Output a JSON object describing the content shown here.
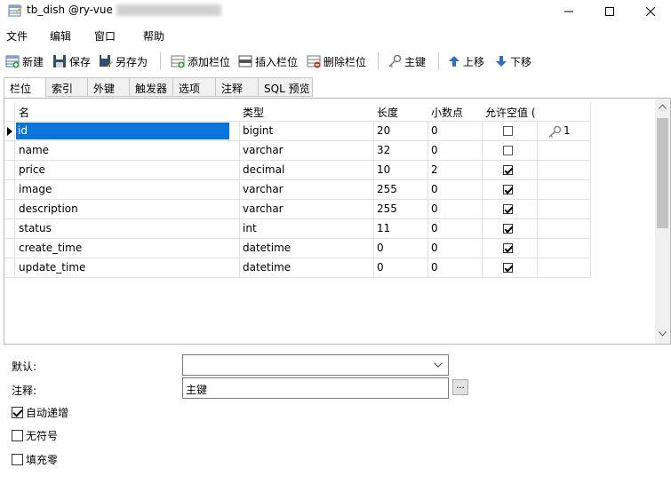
{
  "window": {
    "title": "tb_dish @ry-vue",
    "minimize_icon": "minimize-icon",
    "maximize_icon": "maximize-icon",
    "close_icon": "close-icon"
  },
  "menu": [
    "文件",
    "编辑",
    "窗口",
    "帮助"
  ],
  "toolbar": {
    "new": "新建",
    "save": "保存",
    "save_as": "另存为",
    "add_field": "添加栏位",
    "insert_field": "插入栏位",
    "delete_field": "删除栏位",
    "primary_key": "主键",
    "move_up": "上移",
    "move_down": "下移"
  },
  "tabs": [
    "栏位",
    "索引",
    "外键",
    "触发器",
    "选项",
    "注释",
    "SQL 预览"
  ],
  "grid": {
    "headers": [
      "名",
      "类型",
      "长度",
      "小数点",
      "允许空值 ("
    ],
    "rows": [
      {
        "name": "id",
        "type": "bigint",
        "length": "20",
        "decimals": "0",
        "nullable": false,
        "key": "1"
      },
      {
        "name": "name",
        "type": "varchar",
        "length": "32",
        "decimals": "0",
        "nullable": false,
        "key": ""
      },
      {
        "name": "price",
        "type": "decimal",
        "length": "10",
        "decimals": "2",
        "nullable": true,
        "key": ""
      },
      {
        "name": "image",
        "type": "varchar",
        "length": "255",
        "decimals": "0",
        "nullable": true,
        "key": ""
      },
      {
        "name": "description",
        "type": "varchar",
        "length": "255",
        "decimals": "0",
        "nullable": true,
        "key": ""
      },
      {
        "name": "status",
        "type": "int",
        "length": "11",
        "decimals": "0",
        "nullable": true,
        "key": ""
      },
      {
        "name": "create_time",
        "type": "datetime",
        "length": "0",
        "decimals": "0",
        "nullable": true,
        "key": ""
      },
      {
        "name": "update_time",
        "type": "datetime",
        "length": "0",
        "decimals": "0",
        "nullable": true,
        "key": ""
      }
    ]
  },
  "props": {
    "default_label": "默认:",
    "default_value": "",
    "comment_label": "注释:",
    "comment_value": "主键",
    "ellipsis": "...",
    "auto_increment_label": "自动递增",
    "auto_increment": true,
    "unsigned_label": "无符号",
    "unsigned": false,
    "zerofill_label": "填充零",
    "zerofill": false
  },
  "colors": {
    "selection": "#0a74d8",
    "accent_blue": "#2b6fc2",
    "grid_line": "#e2e2e2"
  }
}
